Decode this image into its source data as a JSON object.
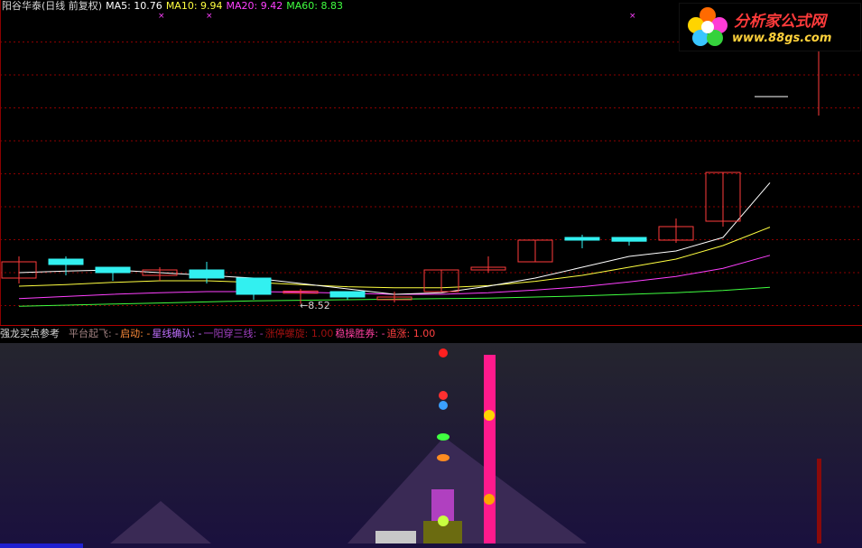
{
  "top_legend": {
    "stock_name": "阳谷华泰(日线 前复权)",
    "ma5": "MA5: 10.76",
    "ma10": "MA10: 9.94",
    "ma20": "MA20: 9.42",
    "ma60": "MA60: 8.83"
  },
  "low_price_label": "←8.52",
  "logo": {
    "title": "分析家公式网",
    "url": "www.88gs.com"
  },
  "indicator_legend": {
    "name": "强龙买点参考",
    "platform": "平台起飞: -",
    "start": "启动: -",
    "star_confirm": "星线确认: -",
    "yang_three": "一阳穿三线: -",
    "limit_spiral": "涨停螺旋: 1.00",
    "steady_win": "稳操胜券: -",
    "chase": "追涨: 1.00"
  },
  "colors": {
    "up": "#ff3b3b",
    "down": "#32f0f0",
    "ma5": "#ffffff",
    "ma10": "#ffff40",
    "ma20": "#ff40ff",
    "ma60": "#40ff40",
    "grid": "#8b0000"
  },
  "chart_data": {
    "type": "candlestick",
    "candles": [
      {
        "o": 9.0,
        "c": 9.3,
        "h": 9.4,
        "l": 8.9
      },
      {
        "o": 9.35,
        "c": 9.25,
        "h": 9.4,
        "l": 9.05
      },
      {
        "o": 9.2,
        "c": 9.1,
        "h": 9.2,
        "l": 8.95
      },
      {
        "o": 9.05,
        "c": 9.15,
        "h": 9.2,
        "l": 8.95
      },
      {
        "o": 9.15,
        "c": 9.0,
        "h": 9.3,
        "l": 8.9
      },
      {
        "o": 9.0,
        "c": 8.7,
        "h": 9.0,
        "l": 8.6
      },
      {
        "o": 8.72,
        "c": 8.76,
        "h": 8.8,
        "l": 8.52
      },
      {
        "o": 8.75,
        "c": 8.65,
        "h": 8.75,
        "l": 8.6
      },
      {
        "o": 8.6,
        "c": 8.65,
        "h": 8.75,
        "l": 8.55
      },
      {
        "o": 8.75,
        "c": 9.15,
        "h": 9.15,
        "l": 8.75
      },
      {
        "o": 9.15,
        "c": 9.2,
        "h": 9.4,
        "l": 9.1
      },
      {
        "o": 9.3,
        "c": 9.7,
        "h": 9.7,
        "l": 9.3
      },
      {
        "o": 9.75,
        "c": 9.7,
        "h": 9.8,
        "l": 9.55
      },
      {
        "o": 9.75,
        "c": 9.68,
        "h": 9.75,
        "l": 9.6
      },
      {
        "o": 9.7,
        "c": 9.95,
        "h": 10.1,
        "l": 9.65
      },
      {
        "o": 10.05,
        "c": 10.95,
        "h": 10.95,
        "l": 9.95
      },
      {
        "o": 12.35,
        "c": 12.35,
        "h": 13.4,
        "l": 12.0
      }
    ],
    "ma5": [
      9.1,
      9.13,
      9.15,
      9.1,
      9.05,
      9.0,
      8.9,
      8.8,
      8.7,
      8.73,
      8.85,
      9.0,
      9.2,
      9.4,
      9.5,
      9.75,
      10.76
    ],
    "ma10": [
      8.85,
      8.88,
      8.92,
      8.95,
      8.95,
      8.92,
      8.88,
      8.84,
      8.82,
      8.82,
      8.86,
      8.94,
      9.05,
      9.2,
      9.35,
      9.6,
      9.94
    ],
    "ma20": [
      8.62,
      8.66,
      8.7,
      8.73,
      8.75,
      8.75,
      8.74,
      8.72,
      8.7,
      8.7,
      8.73,
      8.78,
      8.84,
      8.93,
      9.03,
      9.18,
      9.42
    ],
    "ma60": [
      8.48,
      8.5,
      8.52,
      8.54,
      8.56,
      8.58,
      8.59,
      8.6,
      8.61,
      8.62,
      8.63,
      8.65,
      8.67,
      8.7,
      8.73,
      8.77,
      8.83
    ],
    "low_marker": 8.52,
    "ylim": [
      8.3,
      13.9
    ]
  },
  "indicator_data": {
    "pink_bar_top": 1.0,
    "left_hill_peak": 0.2,
    "right_hill_peak": 0.5
  }
}
